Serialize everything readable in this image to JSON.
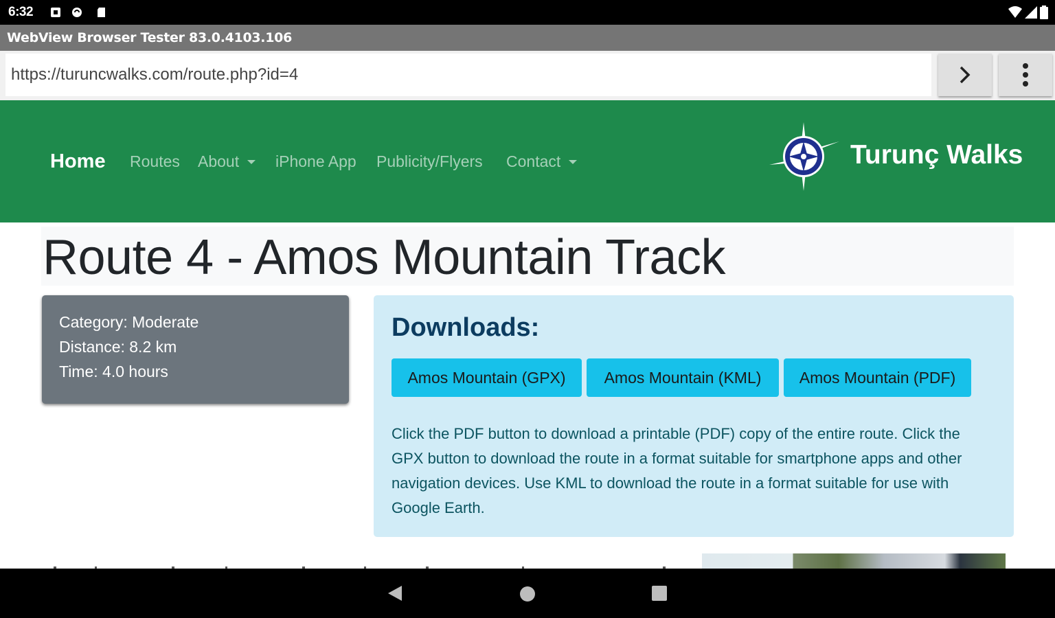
{
  "status_bar": {
    "time": "6:32",
    "left_icons": [
      "notification-square-icon",
      "sync-icon",
      "sd-card-icon"
    ],
    "right_icons": [
      "wifi-icon",
      "cell-signal-icon",
      "battery-icon"
    ]
  },
  "app": {
    "title": "WebView Browser Tester 83.0.4103.106",
    "url": "https://turuncwalks.com/route.php?id=4",
    "go_icon": "chevron-right-icon",
    "menu_icon": "more-vert-icon"
  },
  "site": {
    "nav": {
      "home": "Home",
      "routes": "Routes",
      "about": "About",
      "iphone_app": "iPhone App",
      "publicity": "Publicity/Flyers",
      "contact": "Contact"
    },
    "brand": "Turunç Walks",
    "brand_icon": "compass-rose-logo",
    "colors": {
      "navbar": "#1e8a4c",
      "info_box": "#6c757d",
      "downloads_bg": "#d1ecf7",
      "button": "#17c1ea"
    }
  },
  "route": {
    "title": "Route 4 - Amos Mountain Track",
    "category": "Category: Moderate",
    "distance": "Distance: 8.2 km",
    "time": "Time: 4.0 hours"
  },
  "downloads": {
    "heading": "Downloads:",
    "gpx": "Amos Mountain (GPX)",
    "kml": "Amos Mountain (KML)",
    "pdf": "Amos Mountain (PDF)",
    "description": "Click the PDF button to download a printable (PDF) copy of the entire route. Click the GPX button to download the route in a format suitable for smartphone apps and other navigation devices. Use KML to download the route in a format suitable for use with Google Earth."
  },
  "system_nav": {
    "back": "back-triangle-icon",
    "home": "home-circle-icon",
    "recents": "recents-square-icon"
  }
}
